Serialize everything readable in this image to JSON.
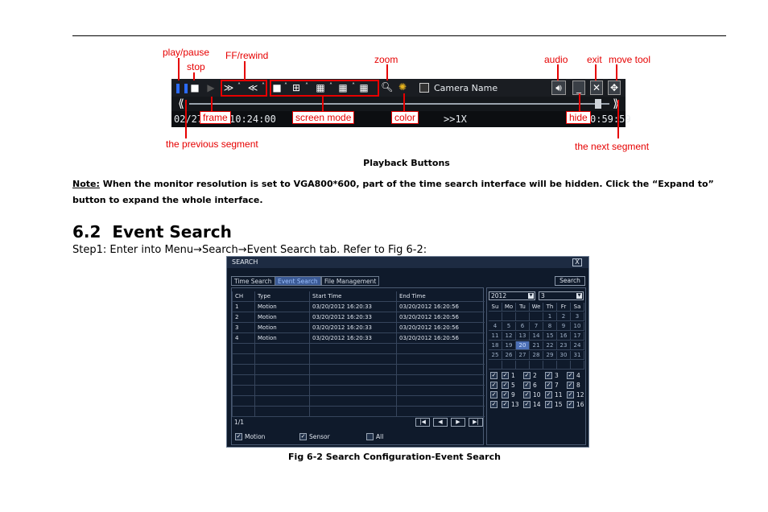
{
  "playback_figure": {
    "toolbar_text": "Camera Name",
    "start_time_prefix": "02/27",
    "start_time": "10:24:00",
    "speed": ">>1X",
    "end_time": "0:59:59",
    "labels": {
      "play_pause": "play/pause",
      "stop": "stop",
      "ff_rewind": "FF/rewind",
      "zoom": "zoom",
      "audio": "audio",
      "exit": "exit",
      "move_tool": "move tool",
      "frame": "frame",
      "screen_mode": "screen mode",
      "color": "color",
      "hide": "hide",
      "previous_segment": "the previous segment",
      "next_segment": "the next segment"
    },
    "caption": "Playback Buttons"
  },
  "note": {
    "label": "Note:",
    "text": " When the monitor resolution is set to VGA800*600, part of the time search interface will be hidden. Click the “Expand to” button to expand the whole interface."
  },
  "section": {
    "number": "6.2",
    "title": "Event Search"
  },
  "step1": "Step1: Enter into Menu→Search→Event Search tab. Refer to Fig 6-2:",
  "search_dialog": {
    "title": "SEARCH",
    "close": "X",
    "tabs": [
      "Time Search",
      "Event Search",
      "File Management"
    ],
    "search_button": "Search",
    "columns": [
      "CH",
      "Type",
      "Start Time",
      "End Time"
    ],
    "rows": [
      [
        "1",
        "Motion",
        "03/20/2012 16:20:33",
        "03/20/2012 16:20:56"
      ],
      [
        "2",
        "Motion",
        "03/20/2012 16:20:33",
        "03/20/2012 16:20:56"
      ],
      [
        "3",
        "Motion",
        "03/20/2012 16:20:33",
        "03/20/2012 16:20:56"
      ],
      [
        "4",
        "Motion",
        "03/20/2012 16:20:33",
        "03/20/2012 16:20:56"
      ]
    ],
    "page": "1/1",
    "filters": [
      "Motion",
      "Sensor",
      "All"
    ],
    "year": "2012",
    "month": "3",
    "weekdays": [
      "Su",
      "Mo",
      "Tu",
      "We",
      "Th",
      "Fr",
      "Sa"
    ],
    "days": [
      "1",
      "2",
      "3",
      "4",
      "5",
      "6",
      "7",
      "8",
      "9",
      "10",
      "11",
      "12",
      "13",
      "14",
      "15",
      "16",
      "17",
      "18",
      "19",
      "20",
      "21",
      "22",
      "23",
      "24",
      "25",
      "26",
      "27",
      "28",
      "29",
      "30",
      "31"
    ],
    "selected_day": "20",
    "channels": [
      "1",
      "2",
      "3",
      "4",
      "5",
      "6",
      "7",
      "8",
      "9",
      "10",
      "11",
      "12",
      "13",
      "14",
      "15",
      "16"
    ]
  },
  "figure_caption": "Fig 6-2 Search Configuration-Event Search"
}
